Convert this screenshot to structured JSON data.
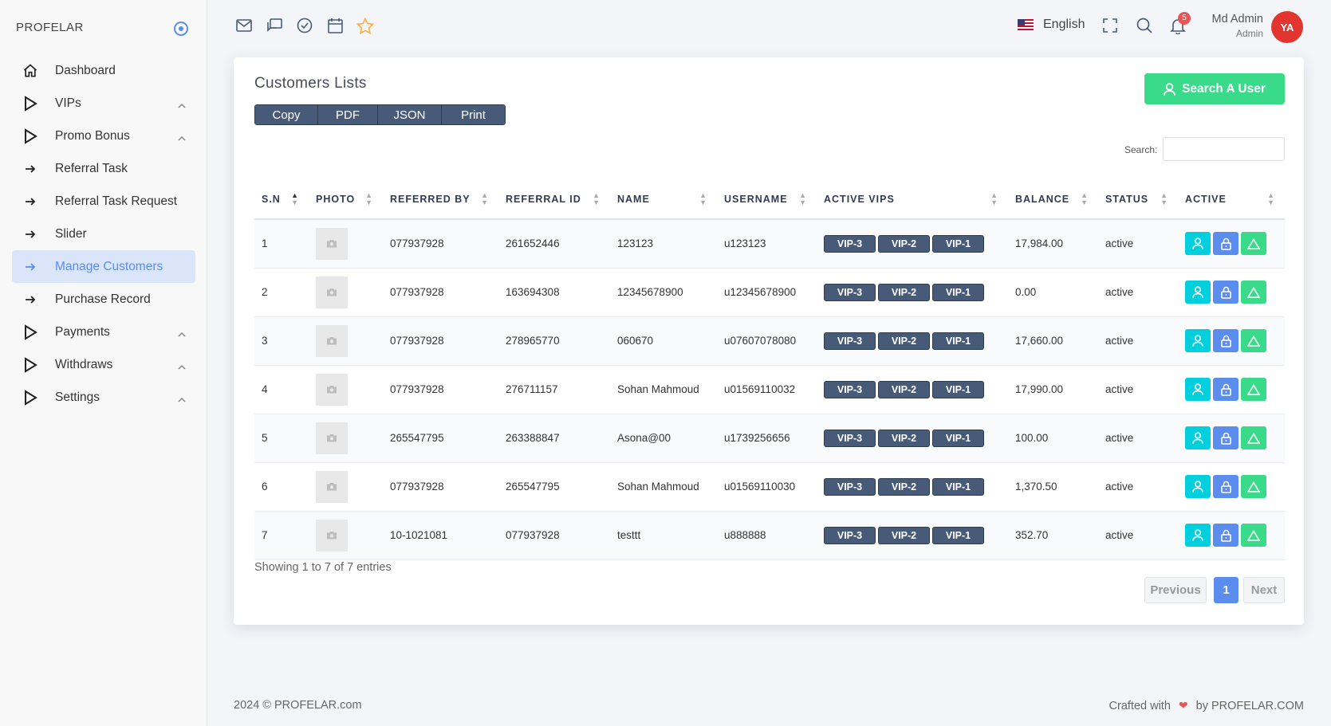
{
  "brand": "PROFELAR",
  "sidebar": {
    "items": [
      {
        "label": "Dashboard",
        "icon": "home-icon"
      },
      {
        "label": "VIPs",
        "icon": "play-icon"
      },
      {
        "label": "Promo Bonus",
        "icon": "play-icon"
      },
      {
        "label": "Referral Task",
        "icon": "arrow-right-icon"
      },
      {
        "label": "Referral Task Request",
        "icon": "arrow-right-icon"
      },
      {
        "label": "Slider",
        "icon": "arrow-right-icon"
      },
      {
        "label": "Manage Customers",
        "icon": "arrow-right-icon"
      },
      {
        "label": "Purchase Record",
        "icon": "arrow-right-icon"
      },
      {
        "label": "Payments",
        "icon": "play-icon"
      },
      {
        "label": "Withdraws",
        "icon": "play-icon"
      },
      {
        "label": "Settings",
        "icon": "play-icon"
      }
    ]
  },
  "topbar": {
    "language": "English",
    "notification_count": "5",
    "user_name": "Md Admin",
    "user_role": "Admin",
    "avatar_text": "YA"
  },
  "card": {
    "title": "Customers Lists",
    "search_user_label": "Search A User",
    "export_buttons": [
      "Copy",
      "PDF",
      "JSON",
      "Print"
    ],
    "search_label": "Search:",
    "search_value": ""
  },
  "table": {
    "columns": [
      "S.N",
      "PHOTO",
      "REFERRED BY",
      "REFERRAL ID",
      "NAME",
      "USERNAME",
      "ACTIVE VIPS",
      "BALANCE",
      "STATUS",
      "ACTIVE"
    ],
    "rows": [
      {
        "sn": "1",
        "referred_by": "077937928",
        "referral_id": "261652446",
        "name": "123123",
        "username": "u123123",
        "vips": [
          "VIP-3",
          "VIP-2",
          "VIP-1"
        ],
        "balance": "17,984.00",
        "status": "active"
      },
      {
        "sn": "2",
        "referred_by": "077937928",
        "referral_id": "163694308",
        "name": "12345678900",
        "username": "u12345678900",
        "vips": [
          "VIP-3",
          "VIP-2",
          "VIP-1"
        ],
        "balance": "0.00",
        "status": "active"
      },
      {
        "sn": "3",
        "referred_by": "077937928",
        "referral_id": "278965770",
        "name": "060670",
        "username": "u07607078080",
        "vips": [
          "VIP-3",
          "VIP-2",
          "VIP-1"
        ],
        "balance": "17,660.00",
        "status": "active"
      },
      {
        "sn": "4",
        "referred_by": "077937928",
        "referral_id": "276711157",
        "name": "Sohan Mahmoud",
        "username": "u01569110032",
        "vips": [
          "VIP-3",
          "VIP-2",
          "VIP-1"
        ],
        "balance": "17,990.00",
        "status": "active"
      },
      {
        "sn": "5",
        "referred_by": "265547795",
        "referral_id": "263388847",
        "name": "Asona@00",
        "username": "u1739256656",
        "vips": [
          "VIP-3",
          "VIP-2",
          "VIP-1"
        ],
        "balance": "100.00",
        "status": "active"
      },
      {
        "sn": "6",
        "referred_by": "077937928",
        "referral_id": "265547795",
        "name": "Sohan Mahmoud",
        "username": "u01569110030",
        "vips": [
          "VIP-3",
          "VIP-2",
          "VIP-1"
        ],
        "balance": "1,370.50",
        "status": "active"
      },
      {
        "sn": "7",
        "referred_by": "10-1021081",
        "referral_id": "077937928",
        "name": "testtt",
        "username": "u888888",
        "vips": [
          "VIP-3",
          "VIP-2",
          "VIP-1"
        ],
        "balance": "352.70",
        "status": "active"
      }
    ]
  },
  "pagination": {
    "info": "Showing 1 to 7 of 7 entries",
    "previous": "Previous",
    "current": "1",
    "next": "Next"
  },
  "footer": {
    "copyright": "2024 © PROFELAR.com",
    "crafted_with": "Crafted with",
    "by": "by PROFELAR.COM"
  },
  "colors": {
    "accent": "#5a8dee",
    "success": "#39da8a",
    "info": "#00cfdd",
    "vip_badge": "#475b79",
    "danger": "#ea5455"
  }
}
